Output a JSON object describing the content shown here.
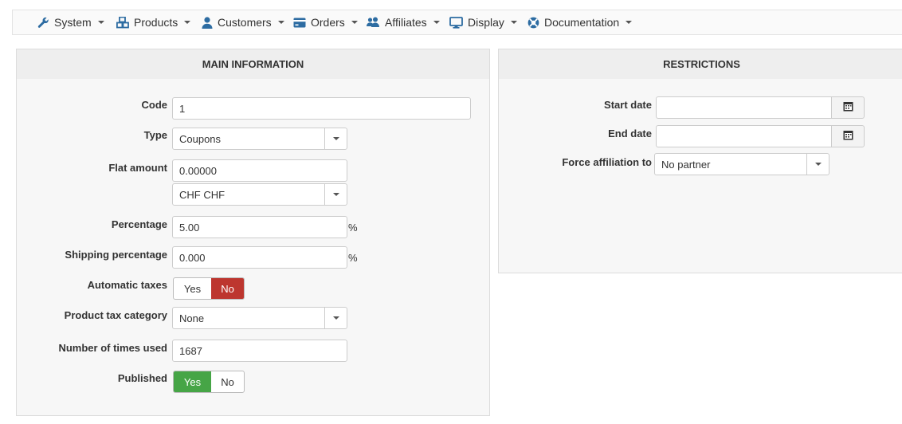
{
  "nav": {
    "items": [
      {
        "label": "System",
        "icon": "wrench-icon"
      },
      {
        "label": "Products",
        "icon": "cubes-icon"
      },
      {
        "label": "Customers",
        "icon": "user-icon"
      },
      {
        "label": "Orders",
        "icon": "credit-card-icon"
      },
      {
        "label": "Affiliates",
        "icon": "users-icon"
      },
      {
        "label": "Display",
        "icon": "monitor-icon"
      },
      {
        "label": "Documentation",
        "icon": "lifebuoy-icon"
      }
    ]
  },
  "main_info": {
    "title": "MAIN INFORMATION",
    "code": {
      "label": "Code",
      "value": "1"
    },
    "type": {
      "label": "Type",
      "value": "Coupons"
    },
    "flat_amount": {
      "label": "Flat amount",
      "value": "0.00000",
      "currency": "CHF CHF"
    },
    "percentage": {
      "label": "Percentage",
      "value": "5.00",
      "suffix": "%"
    },
    "shipping_percentage": {
      "label": "Shipping percentage",
      "value": "0.000",
      "suffix": "%"
    },
    "automatic_taxes": {
      "label": "Automatic taxes",
      "yes": "Yes",
      "no": "No",
      "selected": "No"
    },
    "product_tax_category": {
      "label": "Product tax category",
      "value": "None"
    },
    "times_used": {
      "label": "Number of times used",
      "value": "1687"
    },
    "published": {
      "label": "Published",
      "yes": "Yes",
      "no": "No",
      "selected": "Yes"
    }
  },
  "restrictions": {
    "title": "RESTRICTIONS",
    "start_date": {
      "label": "Start date",
      "value": ""
    },
    "end_date": {
      "label": "End date",
      "value": ""
    },
    "force_affiliation": {
      "label": "Force affiliation to",
      "value": "No partner"
    }
  },
  "colors": {
    "toggle_no_active": "#bd362f",
    "toggle_yes_active": "#46a546",
    "nav_icon": "#2d6ca2"
  }
}
